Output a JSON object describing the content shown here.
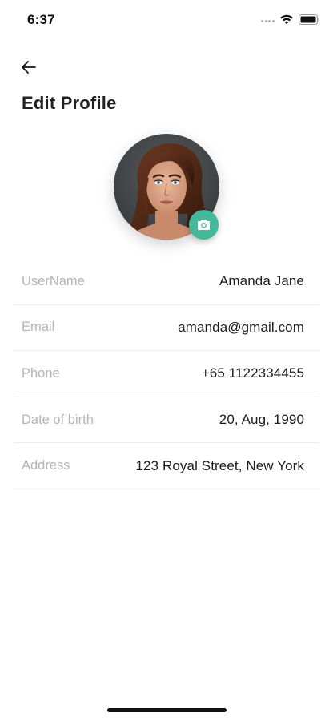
{
  "status_bar": {
    "time": "6:37"
  },
  "header": {
    "title": "Edit Profile",
    "back_icon": "arrow-left-icon"
  },
  "profile": {
    "avatar_alt": "profile photo",
    "camera_icon": "camera-icon",
    "camera_color": "#43b89a"
  },
  "fields": [
    {
      "label": "UserName",
      "value": "Amanda Jane"
    },
    {
      "label": "Email",
      "value": "amanda@gmail.com"
    },
    {
      "label": "Phone",
      "value": "+65 1122334455"
    },
    {
      "label": "Date of birth",
      "value": "20, Aug, 1990"
    },
    {
      "label": "Address",
      "value": "123 Royal Street, New York"
    }
  ]
}
